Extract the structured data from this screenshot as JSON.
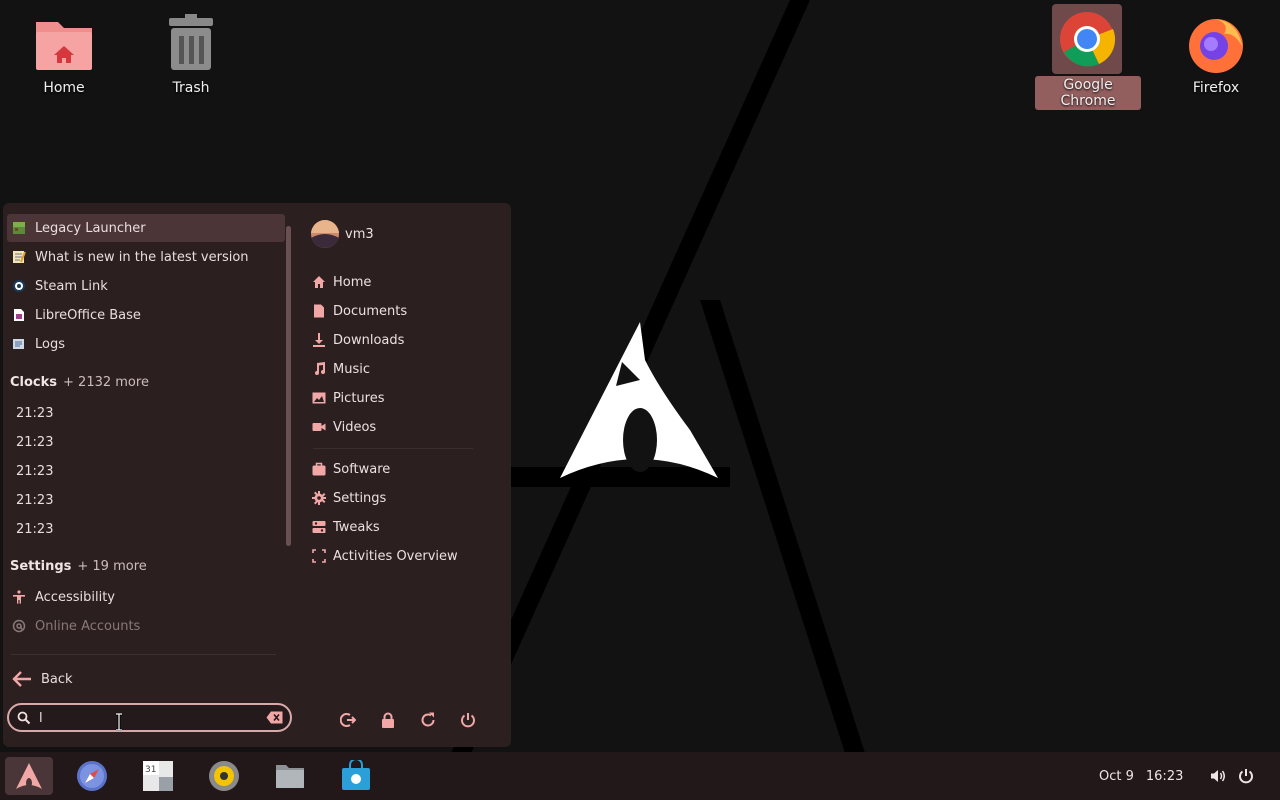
{
  "desktop": {
    "icons": [
      {
        "label": "Home",
        "icon": "home-folder-icon"
      },
      {
        "label": "Trash",
        "icon": "trash-icon"
      },
      {
        "label": "Google Chrome",
        "icon": "chrome-icon",
        "selected": true
      },
      {
        "label": "Firefox",
        "icon": "firefox-icon"
      }
    ]
  },
  "menu": {
    "results": [
      {
        "label": "Legacy Launcher",
        "icon": "legacy-launcher-icon"
      },
      {
        "label": "What is new in the latest version",
        "icon": "notepad-icon"
      },
      {
        "label": "Steam Link",
        "icon": "steam-icon"
      },
      {
        "label": "LibreOffice Base",
        "icon": "libreoffice-base-icon"
      },
      {
        "label": "Logs",
        "icon": "logs-icon"
      }
    ],
    "clocks_section": {
      "title": "Clocks",
      "more": "+ 2132 more",
      "items": [
        "21:23",
        "21:23",
        "21:23",
        "21:23",
        "21:23"
      ]
    },
    "settings_section": {
      "title": "Settings",
      "more": "+ 19 more",
      "items": [
        "Accessibility",
        "Online Accounts"
      ]
    },
    "back_label": "Back",
    "search": {
      "value": "l",
      "placeholder": ""
    },
    "user": {
      "name": "vm3"
    },
    "places": [
      "Home",
      "Documents",
      "Downloads",
      "Music",
      "Pictures",
      "Videos"
    ],
    "system": [
      "Software",
      "Settings",
      "Tweaks",
      "Activities Overview"
    ],
    "power_buttons": [
      "logout-icon",
      "lock-icon",
      "restart-icon",
      "power-icon"
    ]
  },
  "taskbar": {
    "apps": [
      "arch-menu-icon",
      "web-browser-icon",
      "calendar-icon",
      "rhythmbox-icon",
      "files-icon",
      "software-store-icon"
    ],
    "date": "Oct 9",
    "time": "16:23"
  },
  "colors": {
    "accent": "#d9a9a9",
    "menu_bg": "#2c1f20",
    "taskbar_bg": "#221819",
    "icon_pink": "#f2a7a7"
  }
}
